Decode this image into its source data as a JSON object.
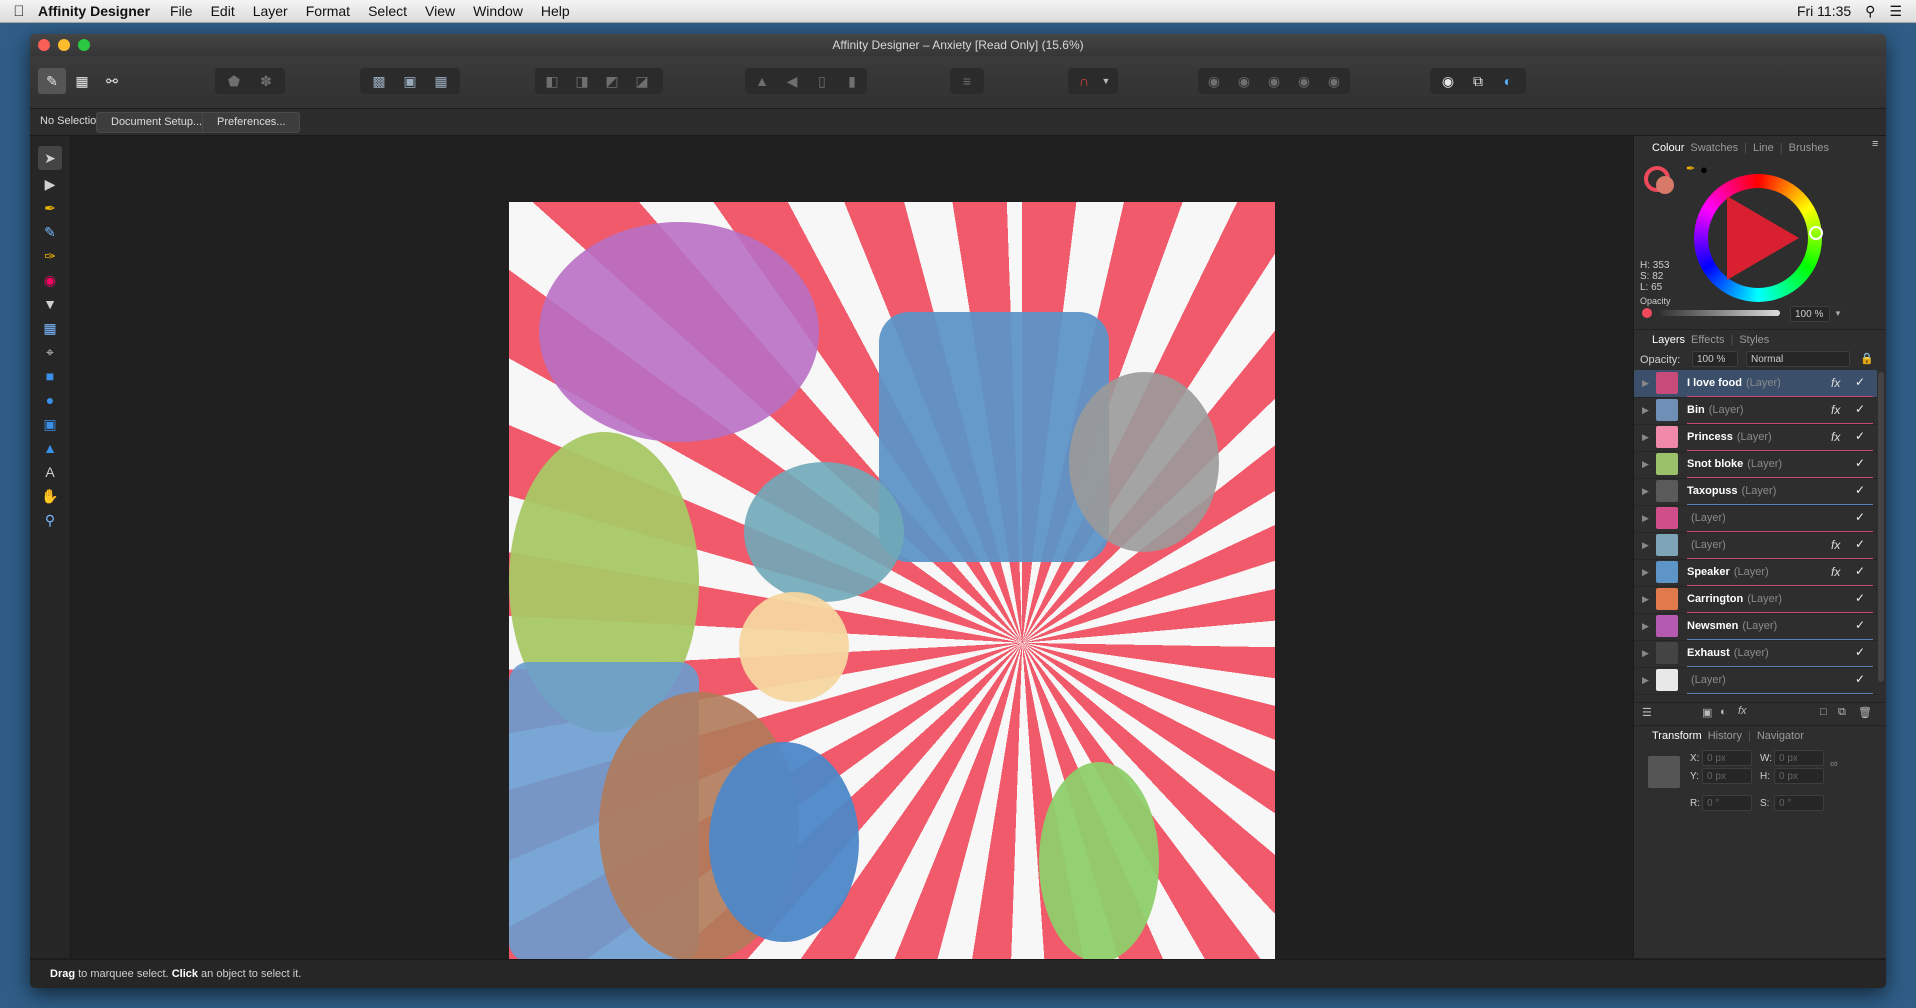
{
  "menubar": {
    "app_name": "Affinity Designer",
    "items": [
      "File",
      "Edit",
      "Layer",
      "Format",
      "Select",
      "View",
      "Window",
      "Help"
    ],
    "clock": "Fri 11:35"
  },
  "window": {
    "title": "Affinity Designer – Anxiety [Read Only] (15.6%)"
  },
  "context_bar": {
    "selection": "No Selection",
    "document_setup": "Document Setup...",
    "preferences": "Preferences..."
  },
  "status_bar": {
    "drag": "Drag",
    "drag_text": "to marquee select.",
    "click": "Click",
    "click_text": "an object to select it."
  },
  "colour_panel": {
    "tabs": [
      "Colour",
      "Swatches",
      "Line",
      "Brushes"
    ],
    "h": "H: 353",
    "s": "S: 82",
    "l": "L: 65",
    "opacity_label": "Opacity",
    "opacity_value": "100 %",
    "current_color": "#ee4a5c"
  },
  "layers_panel": {
    "tabs": [
      "Layers",
      "Effects",
      "Styles"
    ],
    "opacity_label": "Opacity:",
    "opacity_value": "100 %",
    "blend_mode": "Normal",
    "layers": [
      {
        "name": "I love food",
        "type": "(Layer)",
        "fx": "fx",
        "visible": "✓",
        "color": "#c84a7a"
      },
      {
        "name": "Bin",
        "type": "(Layer)",
        "fx": "fx",
        "visible": "✓",
        "color": "#6f8fb7"
      },
      {
        "name": "Princess",
        "type": "(Layer)",
        "fx": "fx",
        "visible": "✓",
        "color": "#f08aa8"
      },
      {
        "name": "Snot bloke",
        "type": "(Layer)",
        "fx": "",
        "visible": "✓",
        "color": "#9bc26b"
      },
      {
        "name": "Taxopuss",
        "type": "(Layer)",
        "fx": "",
        "visible": "✓",
        "color": "#5a5a5a"
      },
      {
        "name": "",
        "type": "(Layer)",
        "fx": "",
        "visible": "✓",
        "color": "#d04f8a"
      },
      {
        "name": "",
        "type": "(Layer)",
        "fx": "fx",
        "visible": "✓",
        "color": "#7ea4b8"
      },
      {
        "name": "Speaker",
        "type": "(Layer)",
        "fx": "fx",
        "visible": "✓",
        "color": "#5d95c7"
      },
      {
        "name": "Carrington",
        "type": "(Layer)",
        "fx": "",
        "visible": "✓",
        "color": "#e07a4a"
      },
      {
        "name": "Newsmen",
        "type": "(Layer)",
        "fx": "",
        "visible": "✓",
        "color": "#b45ab0"
      },
      {
        "name": "Exhaust",
        "type": "(Layer)",
        "fx": "",
        "visible": "✓",
        "color": "#444444"
      },
      {
        "name": "",
        "type": "(Layer)",
        "fx": "",
        "visible": "✓",
        "color": "#e8e8e8"
      }
    ]
  },
  "transform_panel": {
    "tabs": [
      "Transform",
      "History",
      "Navigator"
    ],
    "x_label": "X:",
    "x_value": "0 px",
    "y_label": "Y:",
    "y_value": "0 px",
    "w_label": "W:",
    "w_value": "0 px",
    "h_label": "H:",
    "h_value": "0 px",
    "r_label": "R:",
    "r_value": "0 °",
    "s_label": "S:",
    "s_value": "0 °"
  }
}
